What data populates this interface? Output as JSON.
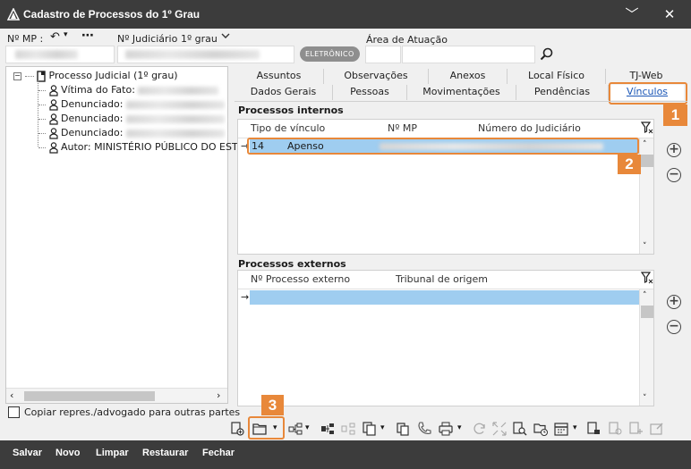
{
  "window": {
    "title": "Cadastro de Processos do 1º Grau",
    "minimize": "﹀",
    "close": "✕"
  },
  "header": {
    "mp_label": "Nº MP :",
    "judiciario_label": "Nº Judiciário",
    "judiciario_grau": "1º grau",
    "badge": "ELETRÔNICO",
    "area_label": "Área de Atuação"
  },
  "tree": {
    "root": "Processo Judicial (1º grau)",
    "items": [
      {
        "label": "Vítima do Fato:"
      },
      {
        "label": "Denunciado:"
      },
      {
        "label": "Denunciado:"
      },
      {
        "label": "Denunciado:"
      },
      {
        "label": "Autor: MINISTÉRIO PÚBLICO DO ESTA"
      }
    ],
    "copy_checkbox_label": "Copiar repres./advogado para outras partes"
  },
  "tabs": {
    "row1": [
      "Assuntos",
      "Observações",
      "Anexos",
      "Local Físico",
      "TJ-Web"
    ],
    "row2": [
      "Dados Gerais",
      "Pessoas",
      "Movimentações",
      "Pendências",
      "Vínculos"
    ]
  },
  "internos": {
    "title": "Processos internos",
    "columns": [
      "Tipo de vínculo",
      "Nº MP",
      "Número do Judiciário"
    ],
    "rows": [
      {
        "tipo_code": "14",
        "tipo": "Apenso"
      }
    ],
    "row_marker": "→"
  },
  "externos": {
    "title": "Processos externos",
    "columns": [
      "Nº Processo externo",
      "Tribunal de origem"
    ],
    "row_marker": "→"
  },
  "callouts": [
    "1",
    "2",
    "3"
  ],
  "bottom": {
    "buttons": [
      "Salvar",
      "Novo",
      "Limpar",
      "Restaurar",
      "Fechar"
    ]
  },
  "colors": {
    "accent": "#e8883a",
    "selection": "#9fcdf0",
    "titlebar": "#3c3c3c"
  }
}
